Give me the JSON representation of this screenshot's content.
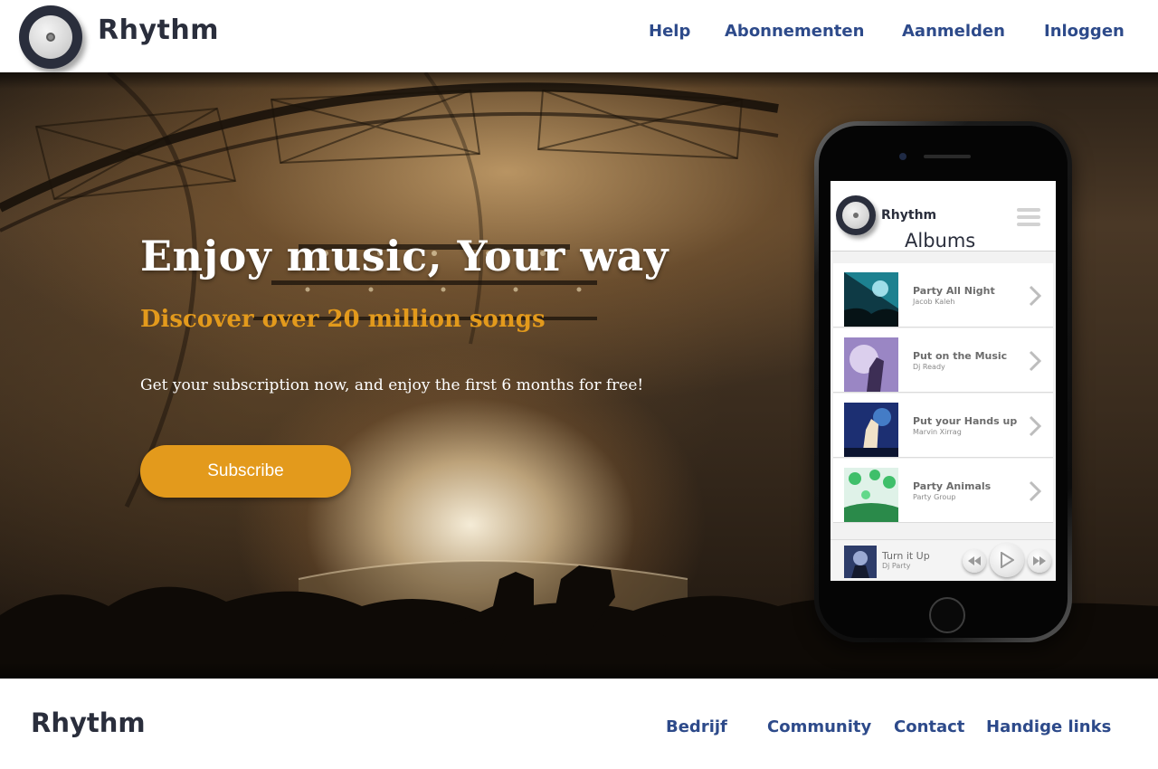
{
  "header": {
    "brand": "Rhythm",
    "nav": {
      "help": "Help",
      "subscriptions": "Abonnementen",
      "register": "Aanmelden",
      "login": "Inloggen"
    }
  },
  "hero": {
    "headline": "Enjoy music, Your way",
    "subheadline": "Discover over 20 million songs",
    "tagline": "Get your subscription now, and enjoy the first 6 months for free!",
    "cta": "Subscribe"
  },
  "phone_app": {
    "brand": "Rhythm",
    "title": "Albums",
    "albums": [
      {
        "title": "Party All Night",
        "artist": "Jacob Kaleh"
      },
      {
        "title": "Put on the Music",
        "artist": "Dj Ready"
      },
      {
        "title": "Put your Hands up",
        "artist": "Marvin Xirrag"
      },
      {
        "title": "Party Animals",
        "artist": "Party Group"
      }
    ],
    "now_playing": {
      "title": "Turn it Up",
      "artist": "Dj Party"
    }
  },
  "footer": {
    "brand": "Rhythm",
    "links": {
      "company": "Bedrijf",
      "community": "Community",
      "contact": "Contact",
      "useful_links": "Handige links"
    }
  },
  "colors": {
    "accent": "#e39a1c",
    "nav_blue": "#2d4a8a",
    "brand_dark": "#2a2e3c"
  }
}
